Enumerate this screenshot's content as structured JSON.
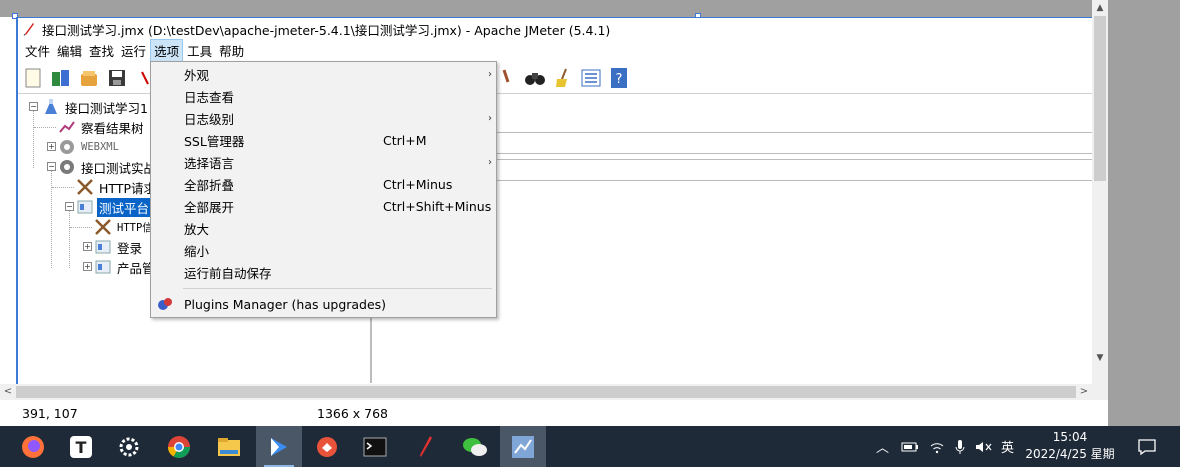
{
  "window": {
    "title": "接口测试学习.jmx (D:\\testDev\\apache-jmeter-5.4.1\\接口测试学习.jmx) - Apache JMeter (5.4.1)"
  },
  "menubar": {
    "items": [
      "文件",
      "编辑",
      "查找",
      "运行",
      "选项",
      "工具",
      "帮助"
    ],
    "active": "选项"
  },
  "tree": {
    "nodes": [
      {
        "label": "接口测试学习1",
        "icon": "test-plan-icon"
      },
      {
        "label": "察看结果树",
        "icon": "results-tree-icon"
      },
      {
        "label": "WEBXML",
        "icon": "gear-icon"
      },
      {
        "label": "接口测试实战",
        "icon": "gear-icon"
      },
      {
        "label": "HTTP请求默",
        "icon": "tools-icon"
      },
      {
        "label": "测试平台",
        "icon": "controller-icon"
      },
      {
        "label": "HTTP信",
        "icon": "tools-icon"
      },
      {
        "label": "登录",
        "icon": "controller-icon"
      },
      {
        "label": "产品管",
        "icon": "controller-icon"
      }
    ]
  },
  "options_menu": {
    "items": [
      {
        "label": "外观",
        "shortcut": "",
        "submenu": true
      },
      {
        "label": "日志查看",
        "shortcut": "",
        "submenu": false
      },
      {
        "label": "日志级别",
        "shortcut": "",
        "submenu": true
      },
      {
        "label": "SSL管理器",
        "shortcut": "Ctrl+M",
        "submenu": false
      },
      {
        "label": "选择语言",
        "shortcut": "",
        "submenu": true
      },
      {
        "label": "全部折叠",
        "shortcut": "Ctrl+Minus",
        "submenu": false
      },
      {
        "label": "全部展开",
        "shortcut": "Ctrl+Shift+Minus",
        "submenu": false
      },
      {
        "label": "放大",
        "shortcut": "",
        "submenu": false
      },
      {
        "label": "缩小",
        "shortcut": "",
        "submenu": false
      },
      {
        "label": "运行前自动保存",
        "shortcut": "",
        "submenu": false
      }
    ],
    "plugins": {
      "label": "Plugins Manager (has upgrades)",
      "icon": "plugins-icon"
    }
  },
  "status": {
    "coords": "391, 107",
    "resolution": "1366 x 768"
  },
  "taskbar": {
    "apps": [
      "firefox-icon",
      "typora-icon",
      "settings-icon",
      "chrome-icon",
      "file-explorer-icon",
      "feishu-icon",
      "app-icon",
      "terminal-icon",
      "pen-icon",
      "wechat-icon",
      "jmeter-icon"
    ],
    "ime": "英",
    "time": "15:04",
    "date": "2022/4/25 星期一"
  },
  "colors": {
    "selection": "#0a64c8",
    "menu_active": "#cce4f7",
    "taskbar": "#1f2a38"
  }
}
